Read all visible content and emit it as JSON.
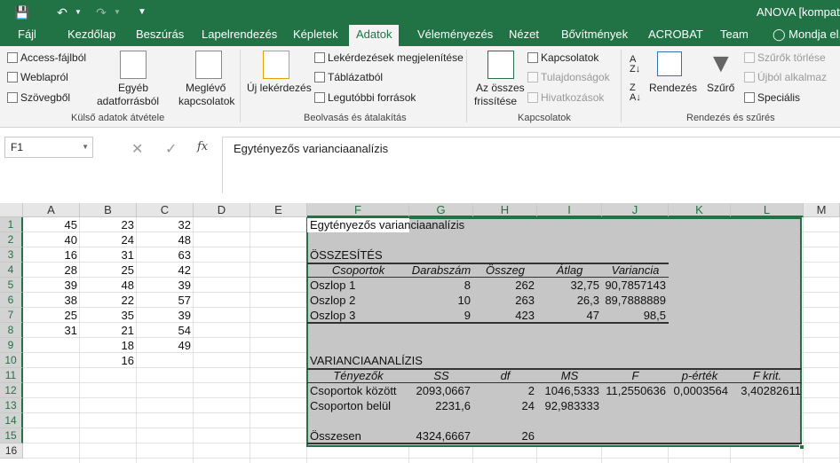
{
  "qat": {
    "save_icon": "save-icon",
    "undo_icon": "undo-icon",
    "redo_icon": "redo-icon",
    "customize_icon": "customize-qat-icon"
  },
  "window": {
    "title": "ANOVA  [kompati"
  },
  "tabs": [
    "Fájl",
    "Kezdőlap",
    "Beszúrás",
    "Lapelrendezés",
    "Képletek",
    "Adatok",
    "Véleményezés",
    "Nézet",
    "Bővítmények",
    "ACROBAT",
    "Team"
  ],
  "tell_me": "Mondja el,",
  "ribbon": {
    "ext_data": {
      "access": "Access-fájlból",
      "web": "Weblapról",
      "text": "Szövegből",
      "other_l1": "Egyéb",
      "other_l2": "adatforrásból",
      "existing_l1": "Meglévő",
      "existing_l2": "kapcsolatok",
      "group": "Külső adatok átvétele"
    },
    "transform": {
      "new_query": "Új lekérdezés",
      "show_queries": "Lekérdezések megjelenítése",
      "from_table": "Táblázatból",
      "recent": "Legutóbbi források",
      "group": "Beolvasás és átalakítás"
    },
    "connections": {
      "refresh_l1": "Az összes",
      "refresh_l2": "frissítése",
      "conn": "Kapcsolatok",
      "props": "Tulajdonságok",
      "edit_links": "Hivatkozások",
      "group": "Kapcsolatok"
    },
    "sort": {
      "sort": "Rendezés",
      "filter": "Szűrő",
      "clear": "Szűrők törlése",
      "reapply": "Újból alkalmaz",
      "advanced": "Speciális",
      "group": "Rendezés és szűrés"
    }
  },
  "formula_bar": {
    "name_box": "F1",
    "fx": "fx",
    "content": "Egytényezős varianciaanalízis"
  },
  "columns": [
    "A",
    "B",
    "C",
    "D",
    "E",
    "F",
    "G",
    "H",
    "I",
    "J",
    "K",
    "L",
    "M"
  ],
  "rows": [
    "1",
    "2",
    "3",
    "4",
    "5",
    "6",
    "7",
    "8",
    "9",
    "10",
    "11",
    "12",
    "13",
    "14",
    "15",
    "16"
  ],
  "raw_data": {
    "A": [
      "45",
      "40",
      "16",
      "28",
      "39",
      "38",
      "25",
      "31"
    ],
    "B": [
      "23",
      "24",
      "31",
      "25",
      "48",
      "22",
      "35",
      "21",
      "18",
      "16"
    ],
    "C": [
      "32",
      "48",
      "63",
      "42",
      "39",
      "57",
      "39",
      "54",
      "49"
    ]
  },
  "anova": {
    "title": "Egytényezős varianciaanalízis",
    "summary_title": "ÖSSZESÍTÉS",
    "summary_headers": [
      "Csoportok",
      "Darabszám",
      "Összeg",
      "Átlag",
      "Variancia"
    ],
    "summary_rows": [
      [
        "Oszlop 1",
        "8",
        "262",
        "32,75",
        "90,7857143"
      ],
      [
        "Oszlop 2",
        "10",
        "263",
        "26,3",
        "89,7888889"
      ],
      [
        "Oszlop 3",
        "9",
        "423",
        "47",
        "98,5"
      ]
    ],
    "anova_title": "VARIANCIAANALÍZIS",
    "anova_headers": [
      "Tényezők",
      "SS",
      "df",
      "MS",
      "F",
      "p-érték",
      "F krit."
    ],
    "anova_rows": [
      [
        "Csoportok között",
        "2093,0667",
        "2",
        "1046,5333",
        "11,2550636",
        "0,0003564",
        "3,40282611"
      ],
      [
        "Csoporton belül",
        "2231,6",
        "24",
        "92,983333",
        "",
        "",
        ""
      ]
    ],
    "total_row": [
      "Összesen",
      "4324,6667",
      "26"
    ]
  },
  "colors": {
    "excel_green": "#217346",
    "selection": "#c6c6c6"
  }
}
